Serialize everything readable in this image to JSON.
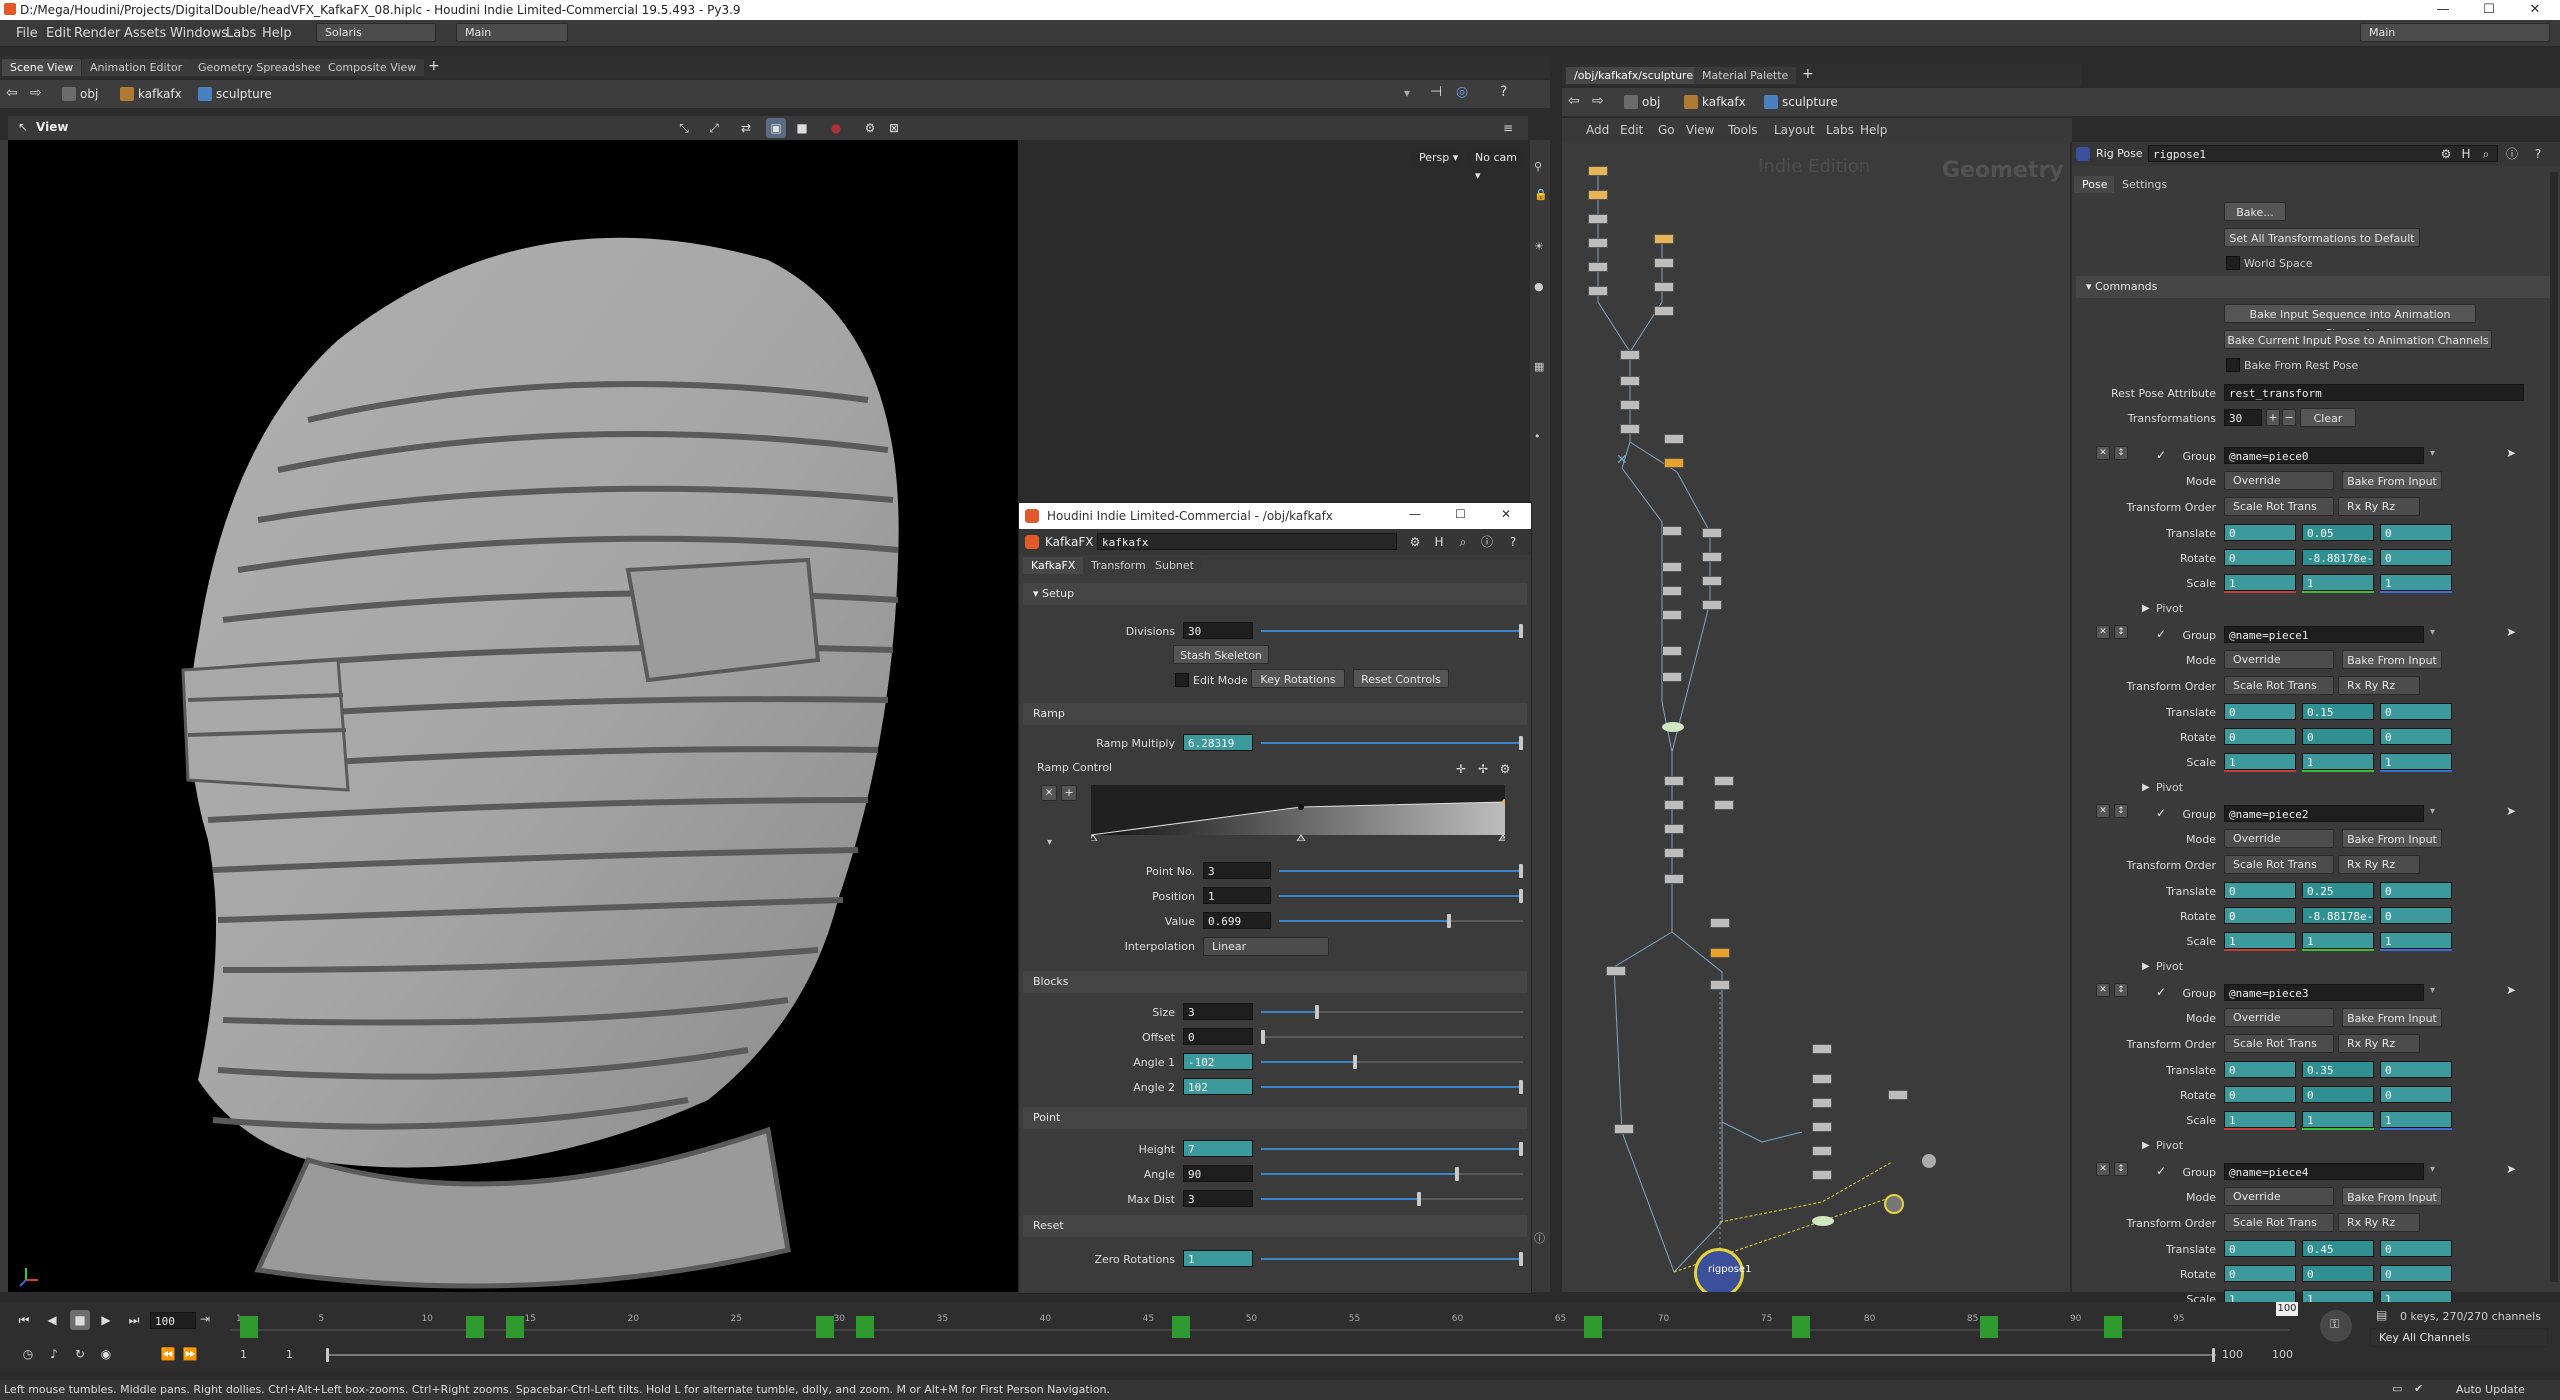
{
  "window": {
    "title": "D:/Mega/Houdini/Projects/DigitalDouble/headVFX_KafkaFX_08.hiplc - Houdini Indie Limited-Commercial 19.5.493 - Py3.9",
    "buttons": [
      "—",
      "☐",
      "✕"
    ]
  },
  "menu": {
    "items": [
      "File",
      "Edit",
      "Render",
      "Assets",
      "Windows",
      "Labs",
      "Help"
    ],
    "desktop": "Solaris",
    "context": "Main",
    "right_context": "Main"
  },
  "left_pane": {
    "tabs": [
      "Scene View",
      "Animation Editor",
      "Geometry Spreadsheet",
      "Composite View"
    ],
    "path": [
      "obj",
      "kafkafx",
      "sculpture"
    ],
    "view_label": "View",
    "persp": "Persp ▾",
    "cam": "No cam ▾"
  },
  "right_pane": {
    "tabs": [
      "/obj/kafkafx/sculpture",
      "Material Palette"
    ],
    "path": [
      "obj",
      "kafkafx",
      "sculpture"
    ],
    "menu": [
      "Add",
      "Edit",
      "Go",
      "View",
      "Tools",
      "Layout",
      "Labs",
      "Help"
    ],
    "watermark1": "Indie Edition",
    "watermark2": "Geometry"
  },
  "float_panel": {
    "title": "Houdini Indie Limited-Commercial - /obj/kafkafx",
    "type": "KafkaFX",
    "name": "kafkafx",
    "tabs": [
      "KafkaFX",
      "Transform",
      "Subnet"
    ],
    "setup_label": "Setup",
    "divisions_label": "Divisions",
    "divisions": "30",
    "stash_btn": "Stash Skeleton",
    "edit_mode": "Edit Mode",
    "key_rot": "Key Rotations",
    "reset_ctrl": "Reset Controls",
    "ramp_header": "Ramp",
    "ramp_mult_label": "Ramp Multiply",
    "ramp_mult": "6.28319",
    "ramp_ctrl_label": "Ramp Control",
    "point_no_label": "Point No.",
    "point_no": "3",
    "position_label": "Position",
    "position": "1",
    "value_label": "Value",
    "value": "0.699",
    "interp_label": "Interpolation",
    "interp": "Linear",
    "blocks_header": "Blocks",
    "size_label": "Size",
    "size": "3",
    "offset_label": "Offset",
    "offset": "0",
    "angle1_label": "Angle 1",
    "angle1": "-102",
    "angle2_label": "Angle 2",
    "angle2": "102",
    "point_header": "Point",
    "height_label": "Height",
    "height": "7",
    "angle_label": "Angle",
    "angle": "90",
    "maxdist_label": "Max Dist",
    "maxdist": "3",
    "reset_header": "Reset",
    "zero_rot_label": "Zero Rotations",
    "zero_rot": "1"
  },
  "params": {
    "node_type": "Rig Pose",
    "node_name": "rigpose1",
    "tabs": [
      "Pose",
      "Settings"
    ],
    "bake_btn": "Bake...",
    "set_all_btn": "Set All Transformations to Default",
    "world_space": "World Space",
    "commands_header": "Commands",
    "bake_seq_btn": "Bake Input Sequence into Animation Channels",
    "bake_cur_btn": "Bake Current Input Pose to Animation Channels",
    "bake_rest": "Bake From Rest Pose",
    "rest_attr_label": "Rest Pose Attribute",
    "rest_attr": "rest_transform",
    "transformations_label": "Transformations",
    "transformations": "30",
    "clear_btn": "Clear",
    "labels": {
      "group": "Group",
      "mode": "Mode",
      "order": "Transform Order",
      "translate": "Translate",
      "rotate": "Rotate",
      "scale": "Scale",
      "pivot": "Pivot",
      "bake_from_input": "Bake From Input"
    },
    "pieces": [
      {
        "group": "@name=piece0",
        "mode": "Override",
        "order": "Scale Rot Trans",
        "rot_order": "Rx Ry Rz",
        "t": [
          "0",
          "0.05",
          "0"
        ],
        "r": [
          "0",
          "-8.88178e-",
          "0"
        ],
        "s": [
          "1",
          "1",
          "1"
        ]
      },
      {
        "group": "@name=piece1",
        "mode": "Override",
        "order": "Scale Rot Trans",
        "rot_order": "Rx Ry Rz",
        "t": [
          "0",
          "0.15",
          "0"
        ],
        "r": [
          "0",
          "0",
          "0"
        ],
        "s": [
          "1",
          "1",
          "1"
        ]
      },
      {
        "group": "@name=piece2",
        "mode": "Override",
        "order": "Scale Rot Trans",
        "rot_order": "Rx Ry Rz",
        "t": [
          "0",
          "0.25",
          "0"
        ],
        "r": [
          "0",
          "-8.88178e-",
          "0"
        ],
        "s": [
          "1",
          "1",
          "1"
        ]
      },
      {
        "group": "@name=piece3",
        "mode": "Override",
        "order": "Scale Rot Trans",
        "rot_order": "Rx Ry Rz",
        "t": [
          "0",
          "0.35",
          "0"
        ],
        "r": [
          "0",
          "0",
          "0"
        ],
        "s": [
          "1",
          "1",
          "1"
        ]
      },
      {
        "group": "@name=piece4",
        "mode": "Override",
        "order": "Scale Rot Trans",
        "rot_order": "Rx Ry Rz",
        "t": [
          "0",
          "0.45",
          "0"
        ],
        "r": [
          "0",
          "0",
          "0"
        ],
        "s": [
          "1",
          "1",
          "1"
        ]
      }
    ]
  },
  "timeline": {
    "frame": "100",
    "start": "1",
    "start2": "1",
    "end": "100",
    "end2": "100",
    "current_marker": "100",
    "ticks": [
      "1",
      "5",
      "10",
      "15",
      "20",
      "25",
      "30",
      "35",
      "40",
      "45",
      "50",
      "55",
      "60",
      "65",
      "70",
      "75",
      "80",
      "85",
      "90",
      "95"
    ],
    "keys_info": "0 keys, 270/270 channels",
    "key_all": "Key All Channels",
    "auto_update": "Auto Update"
  },
  "status": {
    "text": "Left mouse tumbles. Middle pans. Right dollies. Ctrl+Alt+Left box-zooms. Ctrl+Right zooms. Spacebar-Ctrl-Left tilts. Hold L for alternate tumble, dolly, and zoom.    M or Alt+M for First Person Navigation."
  },
  "colors": {
    "accent_teal": "#3d9a9c",
    "keyframe_green": "#2f9a2f",
    "node_orange": "#e8a22a"
  }
}
